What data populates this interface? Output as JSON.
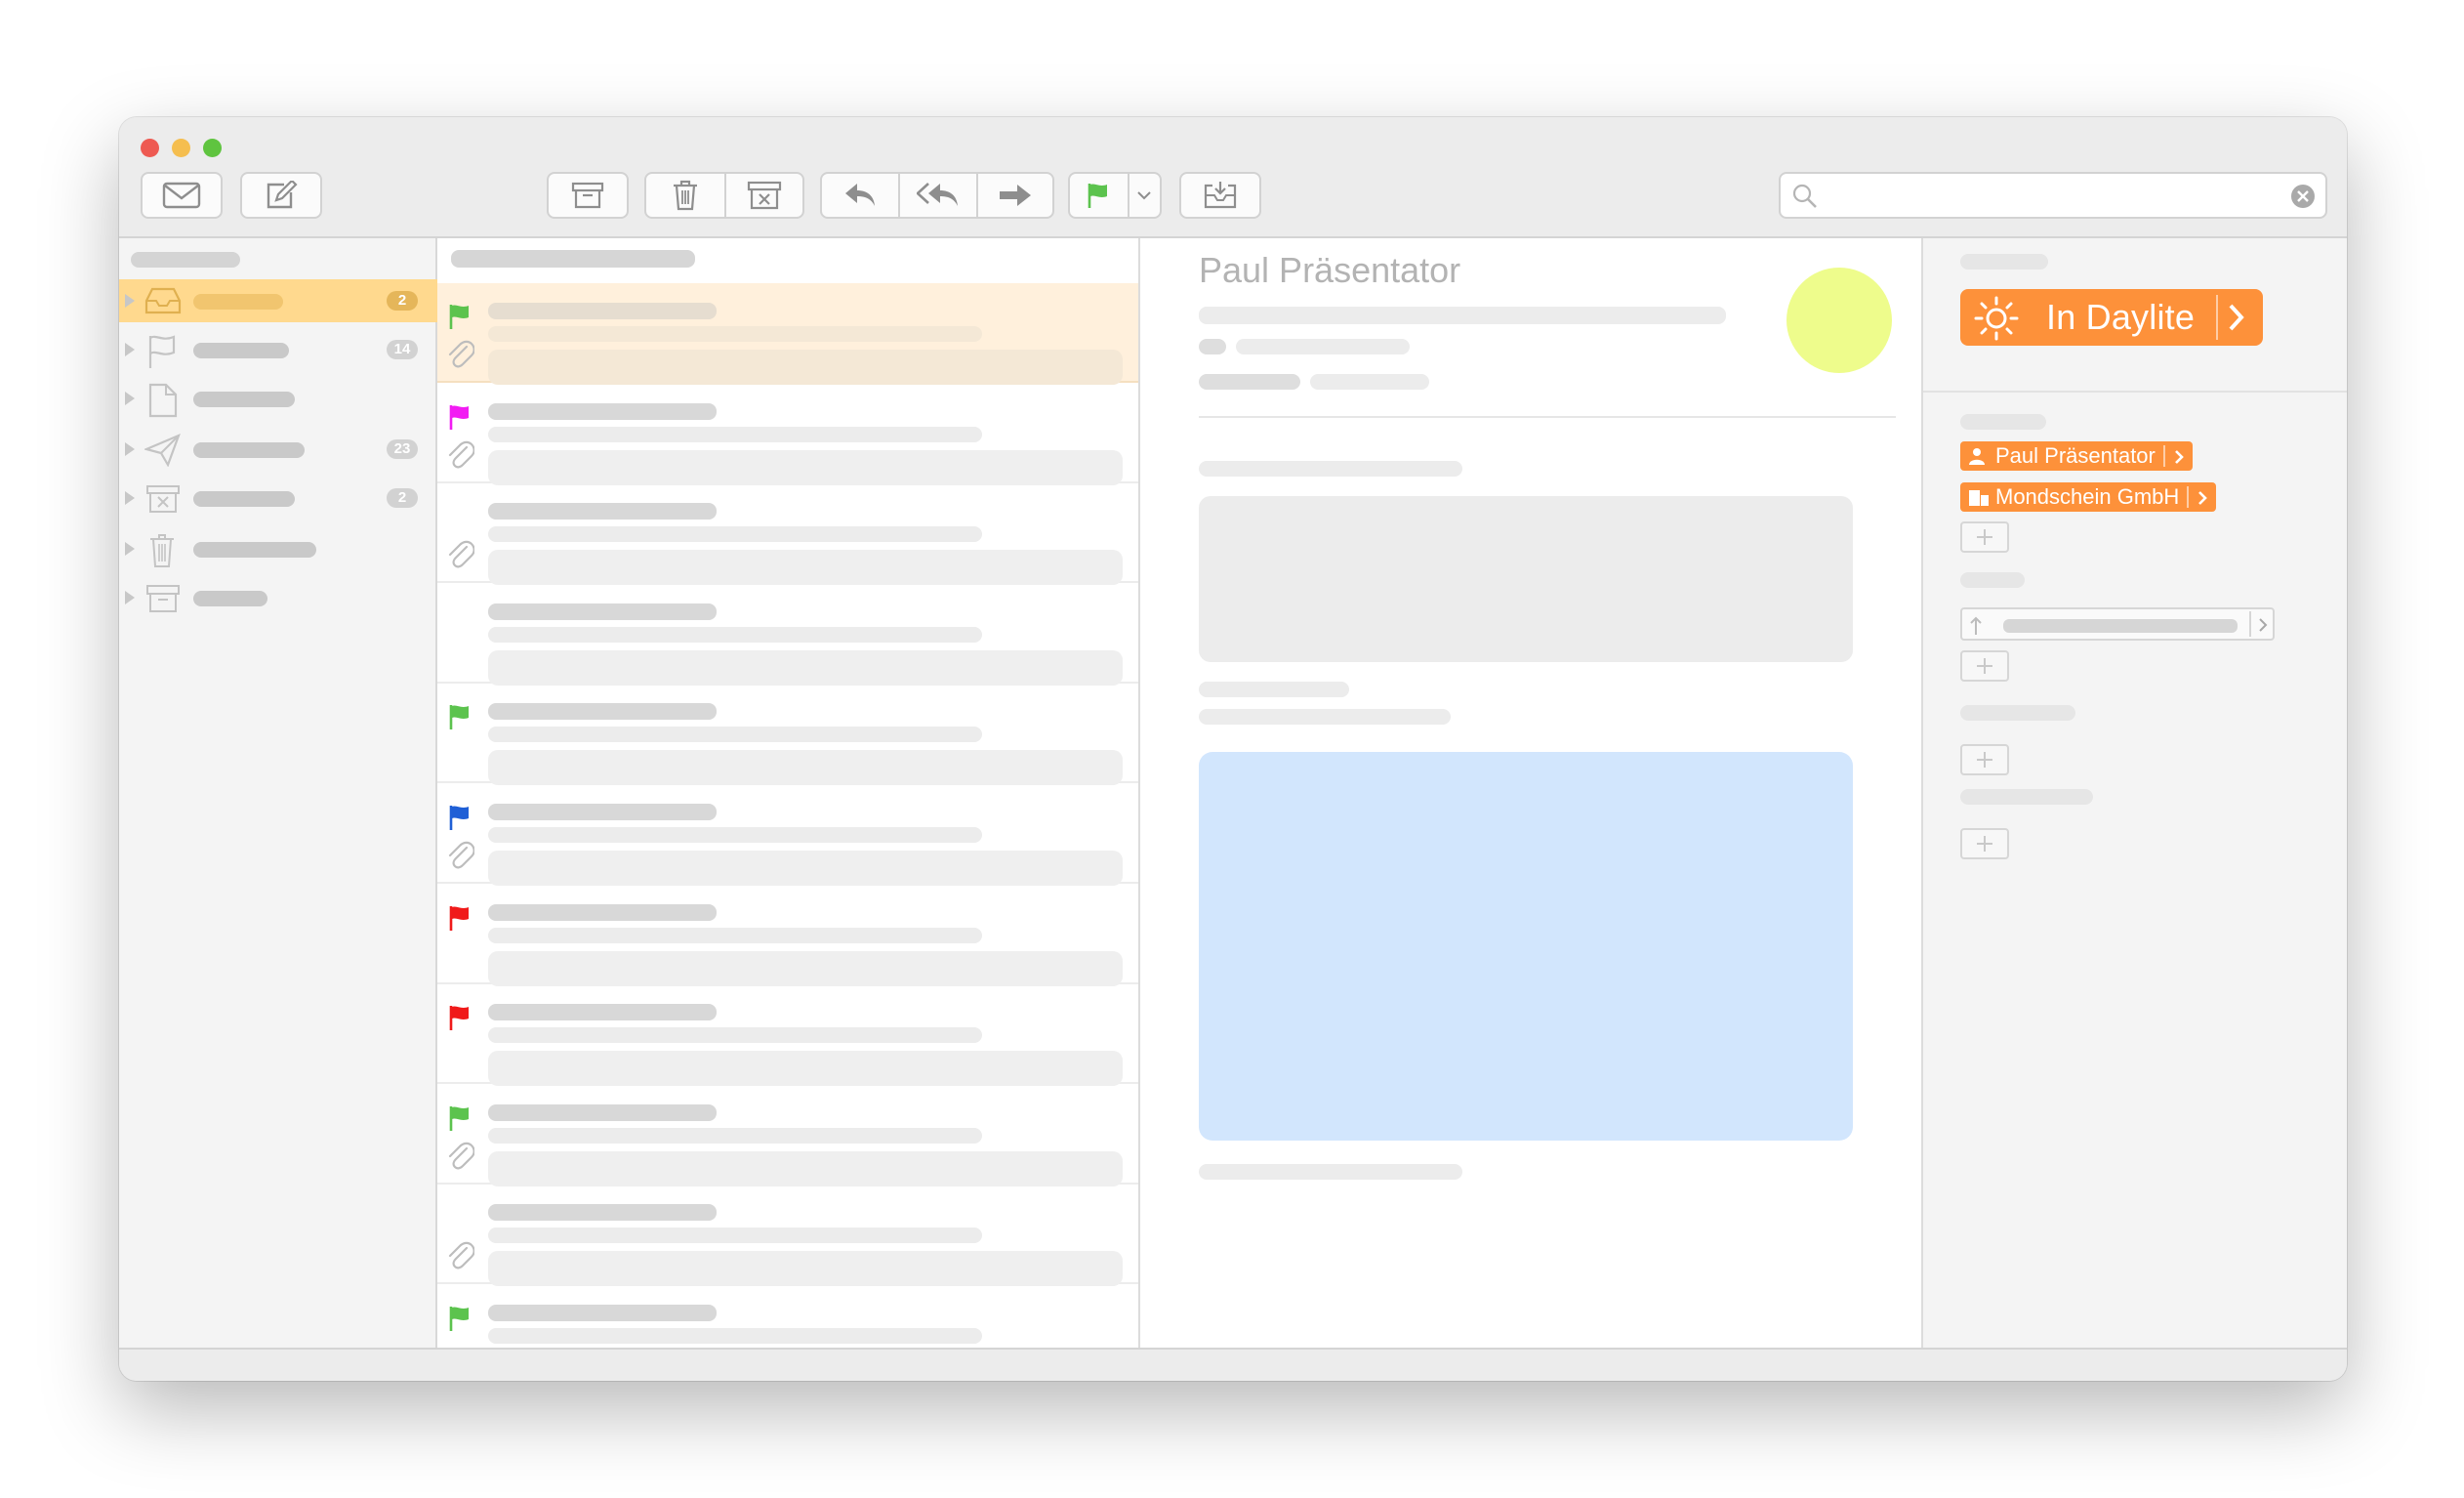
{
  "window": {
    "traffic_lights": {
      "close": "#ee5a52",
      "minimize": "#f5be4f",
      "zoom": "#5fc43f"
    }
  },
  "toolbar": {
    "buttons": [
      "get-mail",
      "compose",
      "archive",
      "delete",
      "junk",
      "reply",
      "reply-all",
      "forward",
      "flag",
      "flag-menu",
      "move"
    ],
    "flag_color": "#5cc34e"
  },
  "search": {
    "placeholder": "",
    "value": ""
  },
  "sidebar": {
    "mailboxes": [
      {
        "icon": "inbox-icon",
        "badge": "2",
        "selected": true
      },
      {
        "icon": "flag-outline-icon",
        "badge": "14"
      },
      {
        "icon": "document-icon",
        "badge": ""
      },
      {
        "icon": "paper-plane-icon",
        "badge": "23"
      },
      {
        "icon": "junk-box-icon",
        "badge": "2"
      },
      {
        "icon": "trash-icon",
        "badge": ""
      },
      {
        "icon": "archive-box-icon",
        "badge": ""
      }
    ]
  },
  "messages": [
    {
      "flag": "#5cc34e",
      "attachment": true,
      "selected": true
    },
    {
      "flag": "#f21cf3",
      "attachment": true
    },
    {
      "flag": "",
      "attachment": true
    },
    {
      "flag": "",
      "attachment": false
    },
    {
      "flag": "#5cc34e",
      "attachment": false
    },
    {
      "flag": "#1f5fd6",
      "attachment": true
    },
    {
      "flag": "#f01a1a",
      "attachment": false
    },
    {
      "flag": "#f01a1a",
      "attachment": false
    },
    {
      "flag": "#5cc34e",
      "attachment": true
    },
    {
      "flag": "",
      "attachment": true
    },
    {
      "flag": "#5cc34e",
      "attachment": false
    }
  ],
  "reader": {
    "sender_name": "Paul Präsentator",
    "avatar_color": "#eefc8c",
    "image_color": "#d2e6fd"
  },
  "daylite": {
    "button_label": "In Daylite",
    "accent": "#fd913a",
    "tags": [
      {
        "icon": "person-icon",
        "label": "Paul Präsentator"
      },
      {
        "icon": "organization-icon",
        "label": "Mondschein GmbH"
      }
    ]
  }
}
